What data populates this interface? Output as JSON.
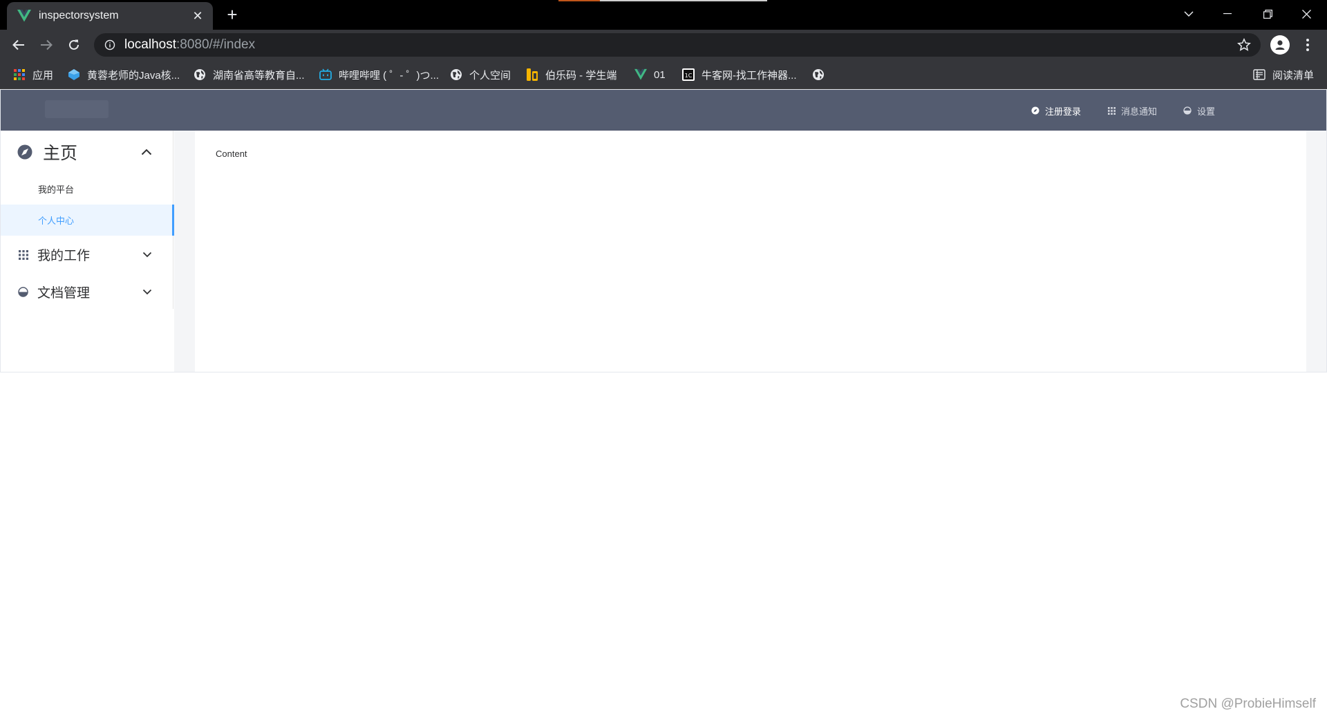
{
  "browser": {
    "tab_title": "inspectorsystem",
    "tab_close": "✕",
    "new_tab": "+",
    "url_host": "localhost",
    "url_path": ":8080/#/index",
    "bookmarks": [
      {
        "label": "应用",
        "icon": "apps-grid-icon"
      },
      {
        "label": "黄蓉老师的Java核...",
        "icon": "gem-icon"
      },
      {
        "label": "湖南省高等教育自...",
        "icon": "globe-icon"
      },
      {
        "label": "哔哩哔哩 ( ゜- ゜)つ...",
        "icon": "bilibili-icon"
      },
      {
        "label": "个人空间",
        "icon": "globe-icon"
      },
      {
        "label": "伯乐码 - 学生端",
        "icon": "bole-icon"
      },
      {
        "label": "01",
        "icon": "vue-icon"
      },
      {
        "label": "牛客网-找工作神器...",
        "icon": "nowcoder-icon"
      },
      {
        "label": "",
        "icon": "globe-icon"
      }
    ],
    "reading_list": "阅读清单"
  },
  "header": {
    "items": [
      {
        "label": "注册登录",
        "icon": "compass-icon",
        "active": true
      },
      {
        "label": "消息通知",
        "icon": "grid-icon",
        "active": false
      },
      {
        "label": "设置",
        "icon": "half-circle-icon",
        "active": false
      }
    ]
  },
  "sidebar": {
    "groups": [
      {
        "title": "主页",
        "icon": "compass-icon",
        "expanded": true,
        "items": [
          {
            "label": "我的平台",
            "active": false
          },
          {
            "label": "个人中心",
            "active": true
          }
        ]
      },
      {
        "title": "我的工作",
        "icon": "grid-icon",
        "expanded": false,
        "items": []
      },
      {
        "title": "文档管理",
        "icon": "half-circle-icon",
        "expanded": false,
        "items": []
      }
    ]
  },
  "main": {
    "content": "Content"
  },
  "watermark": "CSDN @ProbieHimself",
  "colors": {
    "header_bg": "#545c70",
    "active": "#409eff",
    "active_bg": "#ecf5ff"
  }
}
